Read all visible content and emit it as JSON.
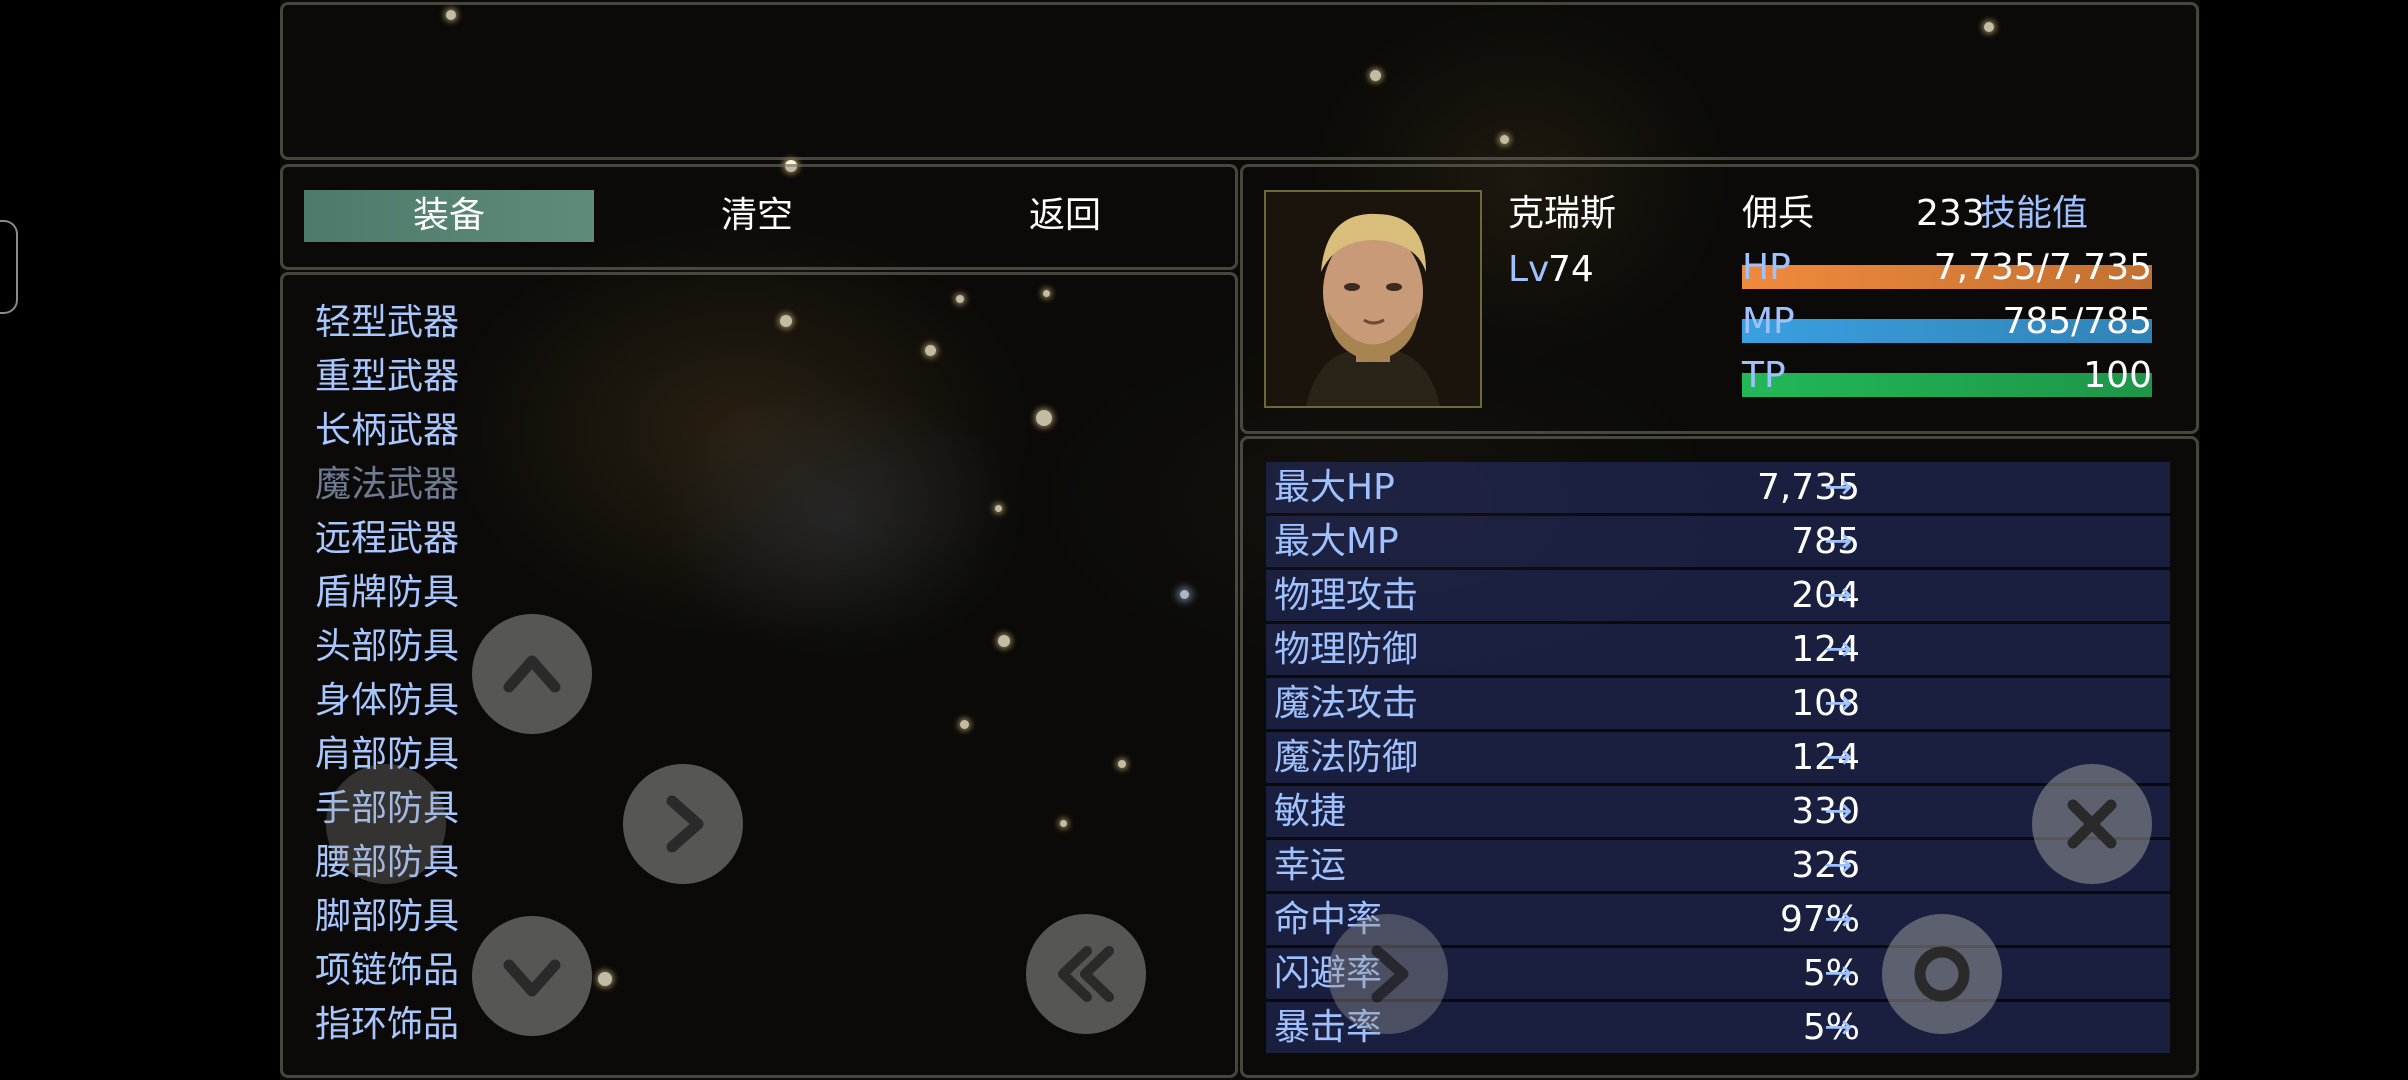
{
  "commands": [
    {
      "label": "装备",
      "selected": true
    },
    {
      "label": "清空",
      "selected": false
    },
    {
      "label": "返回",
      "selected": false
    }
  ],
  "categories": [
    {
      "label": "轻型武器",
      "enabled": true
    },
    {
      "label": "重型武器",
      "enabled": true
    },
    {
      "label": "长柄武器",
      "enabled": true
    },
    {
      "label": "魔法武器",
      "enabled": false
    },
    {
      "label": "远程武器",
      "enabled": true
    },
    {
      "label": "盾牌防具",
      "enabled": true
    },
    {
      "label": "头部防具",
      "enabled": true
    },
    {
      "label": "身体防具",
      "enabled": true
    },
    {
      "label": "肩部防具",
      "enabled": true
    },
    {
      "label": "手部防具",
      "enabled": true
    },
    {
      "label": "腰部防具",
      "enabled": true
    },
    {
      "label": "脚部防具",
      "enabled": true
    },
    {
      "label": "项链饰品",
      "enabled": true
    },
    {
      "label": "指环饰品",
      "enabled": true
    }
  ],
  "actor": {
    "name": "克瑞斯",
    "class": "佣兵",
    "level_label": "Lv",
    "level": "74",
    "skill_points": "233",
    "skill_points_label": "技能值",
    "hp_label": "HP",
    "hp_text": "7,735/7,735",
    "hp_ratio": 1.0,
    "mp_label": "MP",
    "mp_text": "785/785",
    "mp_ratio": 1.0,
    "tp_label": "TP",
    "tp_text": "100",
    "tp_ratio": 1.0
  },
  "colors": {
    "hp": "#f08a3c",
    "mp": "#3aa0e0",
    "tp": "#22b858",
    "system_blue": "#9fc2ff"
  },
  "stats": [
    {
      "name": "最大HP",
      "value": "7,735",
      "arrow": "→"
    },
    {
      "name": "最大MP",
      "value": "785",
      "arrow": "→"
    },
    {
      "name": "物理攻击",
      "value": "204",
      "arrow": "→"
    },
    {
      "name": "物理防御",
      "value": "124",
      "arrow": "→"
    },
    {
      "name": "魔法攻击",
      "value": "108",
      "arrow": "→"
    },
    {
      "name": "魔法防御",
      "value": "124",
      "arrow": "→"
    },
    {
      "name": "敏捷",
      "value": "330",
      "arrow": "→"
    },
    {
      "name": "幸运",
      "value": "326",
      "arrow": "→"
    },
    {
      "name": "命中率",
      "value": "97%",
      "arrow": "→"
    },
    {
      "name": "闪避率",
      "value": "5%",
      "arrow": "→"
    },
    {
      "name": "暴击率",
      "value": "5%",
      "arrow": "→"
    }
  ],
  "controls": [
    "up-button",
    "down-button",
    "right-button",
    "page-back-button",
    "page-next-button",
    "cancel-button",
    "ok-button"
  ]
}
